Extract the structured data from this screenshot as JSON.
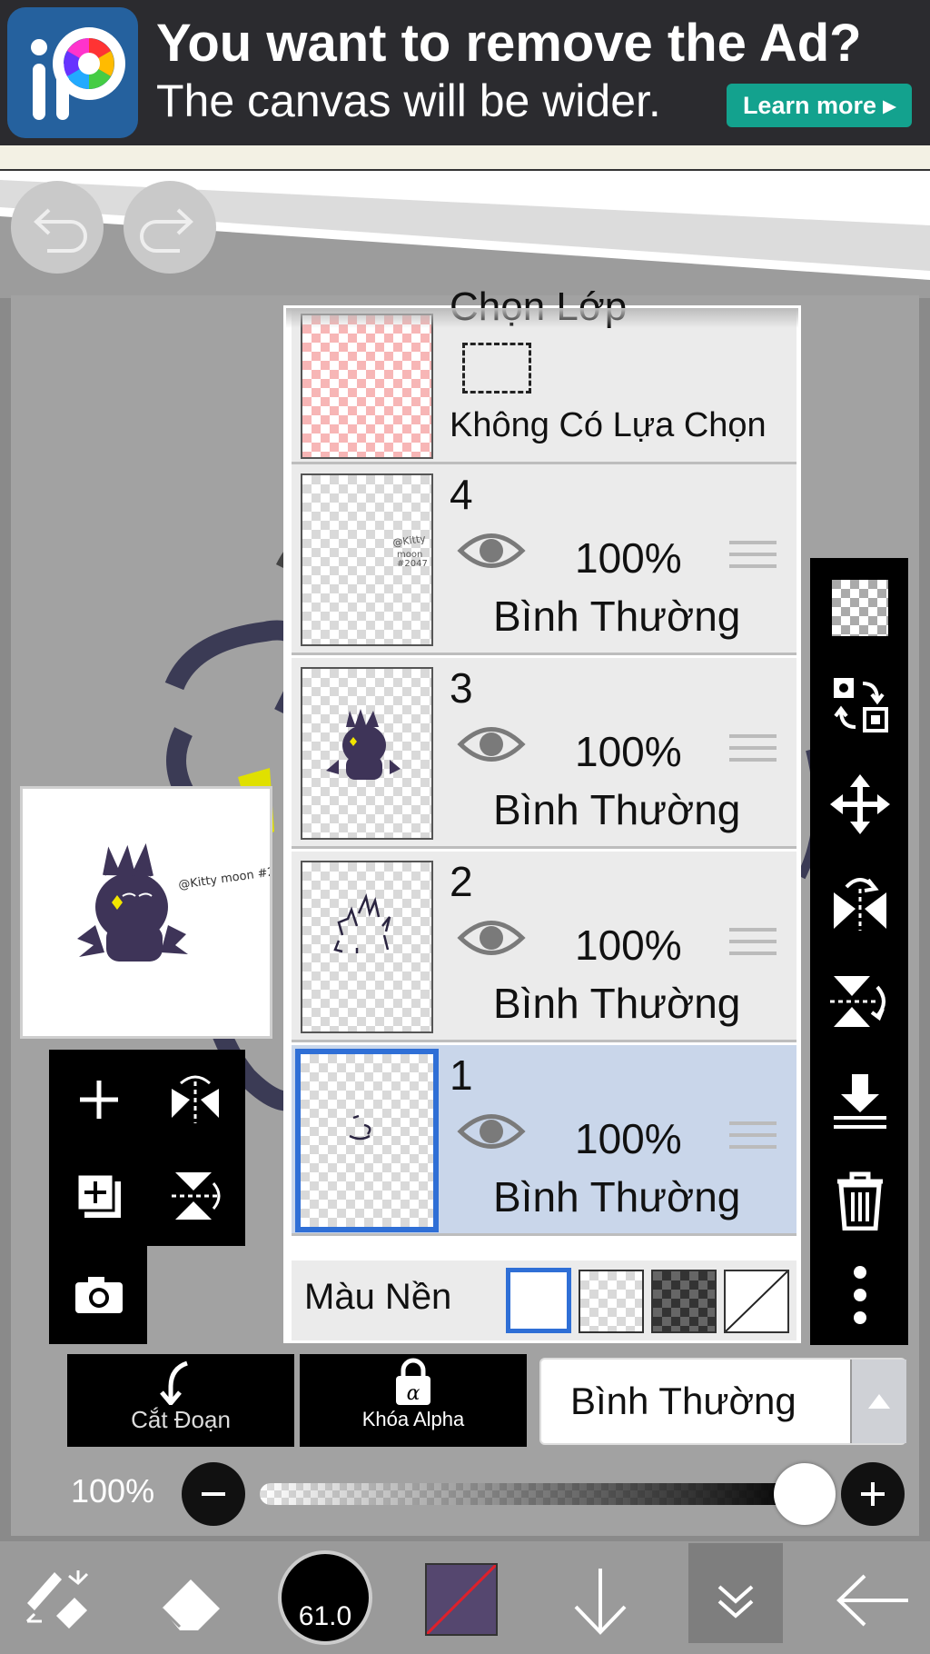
{
  "ad": {
    "title": "You want to remove the Ad?",
    "subtitle": "The canvas will be wider.",
    "button": "Learn more ▸",
    "logo_text": "iP"
  },
  "layers_panel": {
    "selection_layer": {
      "title": "Chọn Lớp",
      "status": "Không Có Lựa Chọn"
    },
    "layers": [
      {
        "num": "4",
        "opacity": "100%",
        "blend": "Bình Thường",
        "selected": false
      },
      {
        "num": "3",
        "opacity": "100%",
        "blend": "Bình Thường",
        "selected": false
      },
      {
        "num": "2",
        "opacity": "100%",
        "blend": "Bình Thường",
        "selected": false
      },
      {
        "num": "1",
        "opacity": "100%",
        "blend": "Bình Thường",
        "selected": true
      }
    ],
    "background_label": "Màu Nền"
  },
  "controls": {
    "clipping_label": "Cắt Đoạn",
    "alpha_lock_label": "Khóa Alpha",
    "blend_mode": "Bình Thường",
    "opacity_label": "100%",
    "opacity_value": 1.0
  },
  "toolbar": {
    "brush_size": "61.0",
    "current_color": "#55476f"
  },
  "colors": {
    "selection_blue": "#2f6fd6",
    "selected_row": "#c9d6ea",
    "ad_button": "#13a28e"
  },
  "thumb_caption": "@Kitty moon #2047"
}
